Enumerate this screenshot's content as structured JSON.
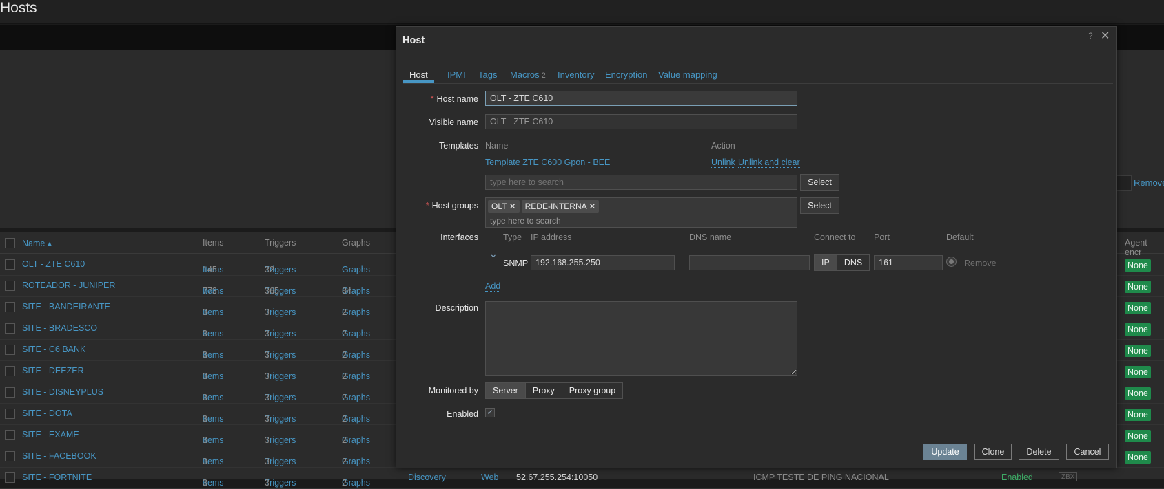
{
  "page": {
    "title": "Hosts"
  },
  "filter": {
    "remove_label": "Remove"
  },
  "hostlist": {
    "columns": {
      "name": "Name ▴",
      "items": "Items",
      "triggers": "Triggers",
      "graphs": "Graphs",
      "agent_enc": "Agent encr"
    },
    "rows": [
      {
        "name": "OLT - ZTE C610",
        "items": "Items",
        "items_count": "145",
        "triggers": "Triggers",
        "triggers_count": "32",
        "graphs": "Graphs",
        "graphs_count": "",
        "agent": "None"
      },
      {
        "name": "ROTEADOR - JUNIPER",
        "items": "Items",
        "items_count": "773",
        "triggers": "Triggers",
        "triggers_count": "365",
        "graphs": "Graphs",
        "graphs_count": "84",
        "agent": "None"
      },
      {
        "name": "SITE - BANDEIRANTE",
        "items": "Items",
        "items_count": "3",
        "triggers": "Triggers",
        "triggers_count": "3",
        "graphs": "Graphs",
        "graphs_count": "2",
        "agent": "None"
      },
      {
        "name": "SITE - BRADESCO",
        "items": "Items",
        "items_count": "3",
        "triggers": "Triggers",
        "triggers_count": "3",
        "graphs": "Graphs",
        "graphs_count": "2",
        "agent": "None"
      },
      {
        "name": "SITE - C6 BANK",
        "items": "Items",
        "items_count": "3",
        "triggers": "Triggers",
        "triggers_count": "3",
        "graphs": "Graphs",
        "graphs_count": "2",
        "agent": "None"
      },
      {
        "name": "SITE - DEEZER",
        "items": "Items",
        "items_count": "3",
        "triggers": "Triggers",
        "triggers_count": "3",
        "graphs": "Graphs",
        "graphs_count": "2",
        "agent": "None"
      },
      {
        "name": "SITE - DISNEYPLUS",
        "items": "Items",
        "items_count": "3",
        "triggers": "Triggers",
        "triggers_count": "3",
        "graphs": "Graphs",
        "graphs_count": "2",
        "agent": "None"
      },
      {
        "name": "SITE - DOTA",
        "items": "Items",
        "items_count": "3",
        "triggers": "Triggers",
        "triggers_count": "3",
        "graphs": "Graphs",
        "graphs_count": "2",
        "agent": "None"
      },
      {
        "name": "SITE - EXAME",
        "items": "Items",
        "items_count": "3",
        "triggers": "Triggers",
        "triggers_count": "3",
        "graphs": "Graphs",
        "graphs_count": "2",
        "agent": "None"
      },
      {
        "name": "SITE - FACEBOOK",
        "items": "Items",
        "items_count": "3",
        "triggers": "Triggers",
        "triggers_count": "3",
        "graphs": "Graphs",
        "graphs_count": "2",
        "agent": "None"
      },
      {
        "name": "SITE - FORTNITE",
        "items": "Items",
        "items_count": "3",
        "triggers": "Triggers",
        "triggers_count": "3",
        "graphs": "Graphs",
        "graphs_count": "2",
        "discovery": "Discovery",
        "web": "Web",
        "interface": "52.67.255.254:10050",
        "templates": "ICMP TESTE DE PING NACIONAL",
        "status": "Enabled",
        "availability": "ZBX"
      }
    ]
  },
  "modal": {
    "title": "Host",
    "help": "?",
    "tabs": [
      {
        "label": "Host"
      },
      {
        "label": "IPMI"
      },
      {
        "label": "Tags"
      },
      {
        "label": "Macros",
        "count": "2"
      },
      {
        "label": "Inventory"
      },
      {
        "label": "Encryption"
      },
      {
        "label": "Value mapping"
      }
    ],
    "host_name_label": "Host name",
    "host_name_value": "OLT - ZTE C610",
    "visible_name_label": "Visible name",
    "visible_name_value": "OLT - ZTE C610",
    "templates_label": "Templates",
    "templates_col_name": "Name",
    "templates_col_action": "Action",
    "template_name": "Template ZTE C600 Gpon - BEE",
    "unlink": "Unlink",
    "unlink_clear": "Unlink and clear",
    "search_placeholder": "type here to search",
    "select_label": "Select",
    "host_groups_label": "Host groups",
    "host_groups": [
      "OLT",
      "REDE-INTERNA"
    ],
    "interfaces_label": "Interfaces",
    "iface_cols": {
      "type": "Type",
      "ip": "IP address",
      "dns": "DNS name",
      "connect": "Connect to",
      "port": "Port",
      "default": "Default"
    },
    "iface": {
      "type": "SNMP",
      "ip": "192.168.255.250",
      "dns": "",
      "connect_ip": "IP",
      "connect_dns": "DNS",
      "port": "161",
      "remove": "Remove"
    },
    "add_label": "Add",
    "description_label": "Description",
    "description_value": "",
    "monitored_by_label": "Monitored by",
    "monitored_options": [
      "Server",
      "Proxy",
      "Proxy group"
    ],
    "enabled_label": "Enabled",
    "enabled": true,
    "footer": {
      "update": "Update",
      "clone": "Clone",
      "delete": "Delete",
      "cancel": "Cancel"
    }
  }
}
